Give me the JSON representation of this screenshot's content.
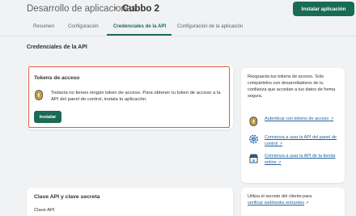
{
  "header": {
    "breadcrumb": "Desarrollo de aplicaciones",
    "separator": "›",
    "app_name": "Cubbo 2",
    "primary_button": "Instalar aplicación"
  },
  "tabs": [
    {
      "label": "Resumen",
      "active": false
    },
    {
      "label": "Configuración",
      "active": false
    },
    {
      "label": "Credenciales de la API",
      "active": true
    },
    {
      "label": "Configuración de la aplicación",
      "active": false
    }
  ],
  "section_heading": "Credenciales de la API",
  "access_tokens_card": {
    "title": "Tokens de acceso",
    "icon": "coin-icon",
    "text": "Todavía no tienes ningún token de acceso. Para obtener tu token de acceso a la API del panel de control, instala tu aplicación.",
    "install_button": "Instalar"
  },
  "side_card": {
    "intro": "Resguarda tus tokens de acceso. Solo compártelos con desarrolladores de tu confianza que accedan a tus datos de forma segura.",
    "links": [
      {
        "icon": "coin-icon",
        "label": "Autenticar con tokens de acceso"
      },
      {
        "icon": "gear-icon",
        "label": "Comienza a usar la API del panel de control"
      },
      {
        "icon": "storefront-icon",
        "label": "Comienza a usar la API de la tienda online"
      }
    ],
    "external_icon": "↗"
  },
  "api_key_card": {
    "title": "Clave API y clave secreta",
    "subtitle": "Clave API"
  },
  "side_card_2": {
    "text": "Utiliza el secreto del cliente para",
    "link": "verificar webhooks entrantes",
    "external_icon": "↗"
  },
  "colors": {
    "brand": "#1a6b54",
    "link": "#1f5f9c",
    "highlight": "#e05a3e",
    "background": "#f1f2f4"
  }
}
